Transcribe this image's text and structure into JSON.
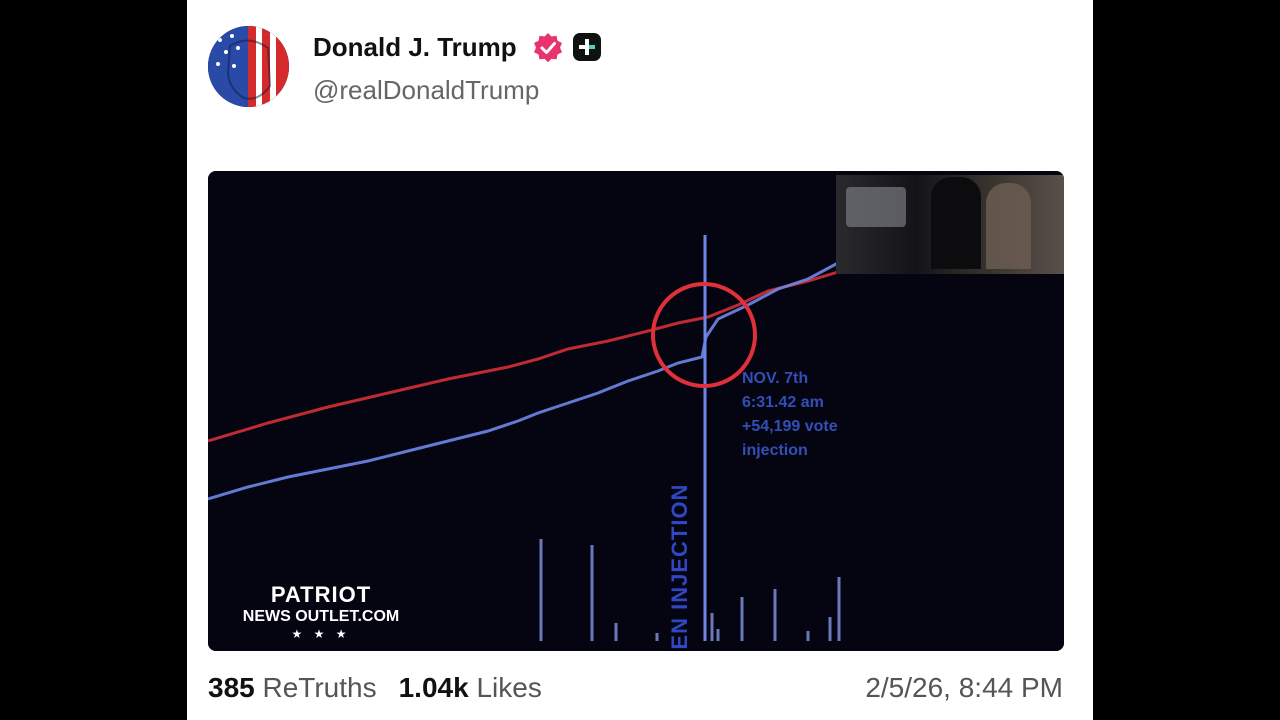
{
  "post": {
    "author": {
      "name": "Donald J. Trump",
      "handle": "@realDonaldTrump",
      "verified_color": "#e8336d"
    },
    "media": {
      "vertical_label": "BIDEN INJECTION",
      "annotation": "NOV. 7th\n6:31.42 am\n+54,199 vote\ninjection",
      "watermark_line1": "PATRIOT",
      "watermark_line2": "NEWS OUTLET.COM",
      "watermark_stars": "★ ★ ★"
    },
    "stats": {
      "retruths_count": "385",
      "retruths_label": "ReTruths",
      "likes_count": "1.04k",
      "likes_label": "Likes"
    },
    "timestamp": "2/5/26, 8:44 PM"
  },
  "colors": {
    "red_line": "#e0313a",
    "blue_line": "#6f86e8",
    "circle": "#e0313a"
  }
}
